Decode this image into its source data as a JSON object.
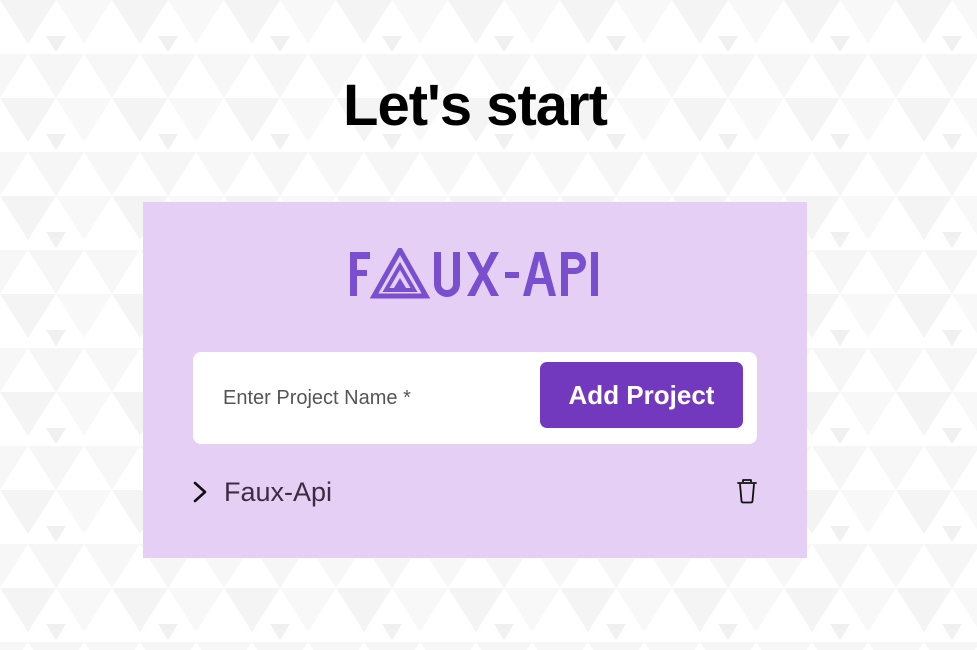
{
  "page": {
    "title": "Let's start"
  },
  "logo": {
    "text": "FAUX-API",
    "color": "#7a4fcf"
  },
  "form": {
    "project_name_placeholder": "Enter Project Name *",
    "project_name_value": "",
    "add_button_label": "Add Project"
  },
  "projects": [
    {
      "name": "Faux-Api",
      "expand_icon": "chevron-right-icon",
      "delete_icon": "trash-icon"
    }
  ],
  "colors": {
    "card_background": "#e5cff5",
    "button_background": "#7239bf",
    "button_text": "#ffffff",
    "title_text": "#000000",
    "page_background": "#ffffff"
  }
}
